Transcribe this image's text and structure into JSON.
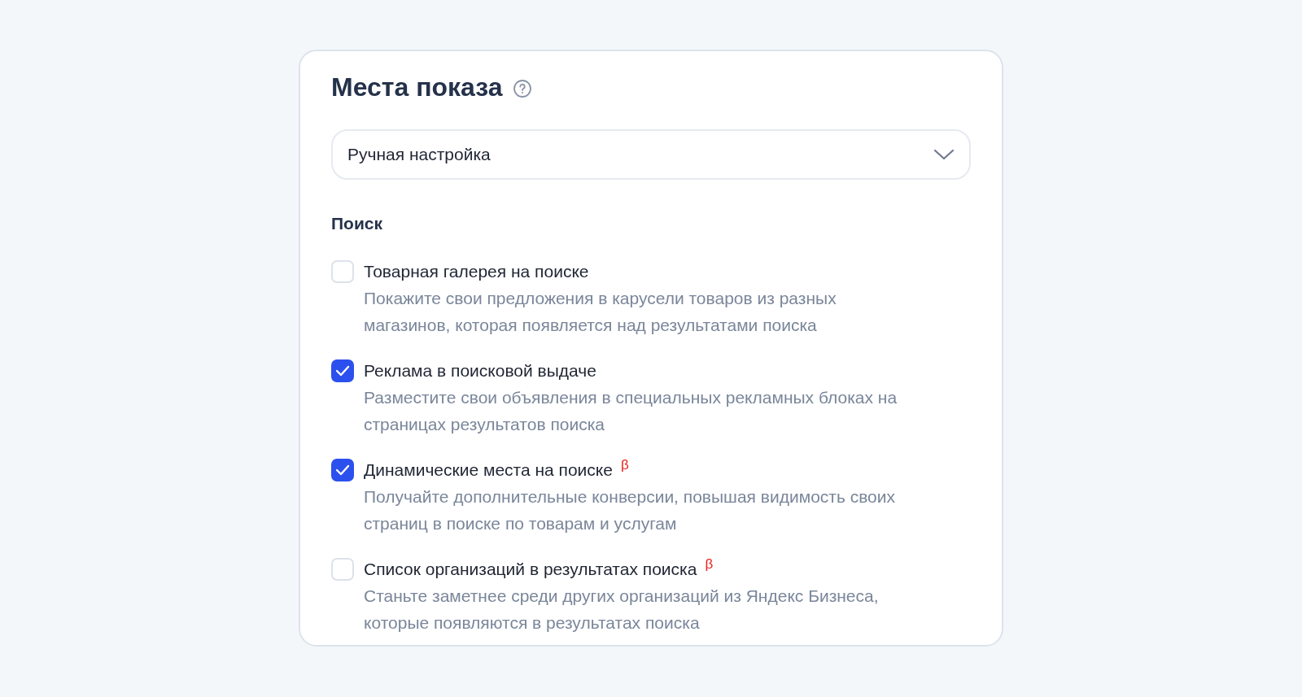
{
  "section": {
    "title": "Места показа"
  },
  "select": {
    "value": "Ручная настройка"
  },
  "group": {
    "title": "Поиск"
  },
  "options": [
    {
      "label": "Товарная галерея на поиске",
      "checked": false,
      "description": "Покажите свои предложения в карусели товаров из разных магазинов, которая появляется над результатами поиска"
    },
    {
      "label": "Реклама в поисковой выдаче",
      "checked": true,
      "description": "Разместите свои объявления в специальных рекламных блоках на страницах результатов поиска"
    },
    {
      "label": "Динамические места на поиске",
      "checked": true,
      "badge": "β",
      "description": "Получайте дополнительные конверсии, повышая видимость своих страниц в поиске по товарам и услугам"
    },
    {
      "label": "Список организаций в результатах поиска",
      "checked": false,
      "badge": "β",
      "description": "Станьте заметнее среди других организаций из Яндекс Бизнеса, которые появляются в результатах поиска"
    }
  ]
}
